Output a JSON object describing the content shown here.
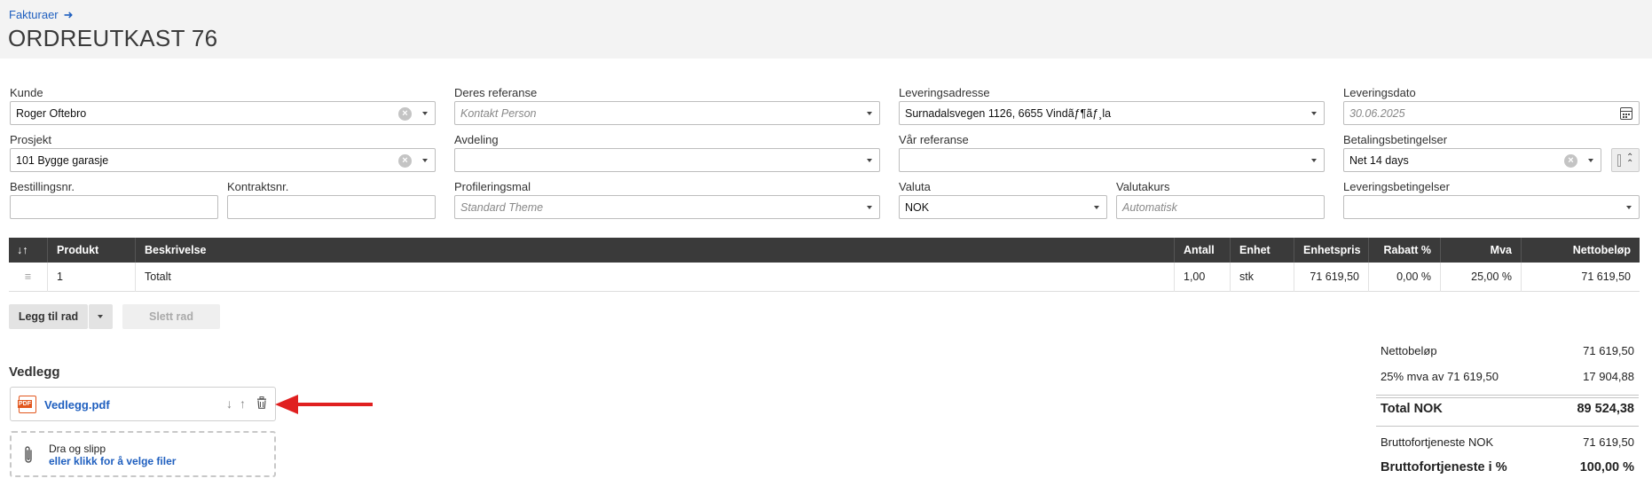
{
  "breadcrumb": {
    "label": "Fakturaer",
    "arrow": "➜"
  },
  "title": "ORDREUTKAST 76",
  "form": {
    "kunde": {
      "label": "Kunde",
      "value": "Roger Oftebro"
    },
    "deres_referanse": {
      "label": "Deres referanse",
      "placeholder": "Kontakt Person"
    },
    "leveringsadresse": {
      "label": "Leveringsadresse",
      "value": "Surnadalsvegen 1126, 6655 Vindãƒ¶ãƒ¸la"
    },
    "leveringsdato": {
      "label": "Leveringsdato",
      "placeholder": "30.06.2025"
    },
    "prosjekt": {
      "label": "Prosjekt",
      "value": "101 Bygge garasje"
    },
    "avdeling": {
      "label": "Avdeling",
      "value": ""
    },
    "var_referanse": {
      "label": "Vår referanse",
      "value": ""
    },
    "betalingsbetingelser": {
      "label": "Betalingsbetingelser",
      "value": "Net 14 days"
    },
    "bestillingsnr": {
      "label": "Bestillingsnr.",
      "value": ""
    },
    "kontraktsnr": {
      "label": "Kontraktsnr.",
      "value": ""
    },
    "profileringsmal": {
      "label": "Profileringsmal",
      "placeholder": "Standard Theme"
    },
    "valuta": {
      "label": "Valuta",
      "value": "NOK"
    },
    "valutakurs": {
      "label": "Valutakurs",
      "placeholder": "Automatisk"
    },
    "leveringsbetingelser": {
      "label": "Leveringsbetingelser",
      "value": ""
    }
  },
  "table": {
    "sort_label": "↓↑",
    "headers": [
      "Produkt",
      "Beskrivelse",
      "Antall",
      "Enhet",
      "Enhetspris",
      "Rabatt %",
      "Mva",
      "Nettobeløp"
    ],
    "rows": [
      {
        "produkt": "1",
        "beskrivelse": "Totalt",
        "antall": "1,00",
        "enhet": "stk",
        "enhetspris": "71 619,50",
        "rabatt": "0,00 %",
        "mva": "25,00 %",
        "netto": "71 619,50"
      }
    ]
  },
  "buttons": {
    "add_row": "Legg til rad",
    "delete_row": "Slett rad"
  },
  "attachments": {
    "title": "Vedlegg",
    "files": [
      {
        "name": "Vedlegg.pdf",
        "icon": "pdf-icon",
        "icon_text": "PDF"
      }
    ],
    "drop_line1": "Dra og slipp",
    "drop_line2": "eller klikk for å velge filer"
  },
  "summary": {
    "netto_label": "Nettobeløp",
    "netto_value": "71 619,50",
    "mva_label": "25% mva av 71 619,50",
    "mva_value": "17 904,88",
    "total_label": "Total NOK",
    "total_value": "89 524,38",
    "brutto_label": "Bruttofortjeneste NOK",
    "brutto_value": "71 619,50",
    "brutto_pct_label": "Bruttofortjeneste i %",
    "brutto_pct_value": "100,00 %"
  },
  "colors": {
    "link": "#1f5fbf",
    "header_bg": "#3a3a3a",
    "annotation_arrow": "#e02020"
  }
}
